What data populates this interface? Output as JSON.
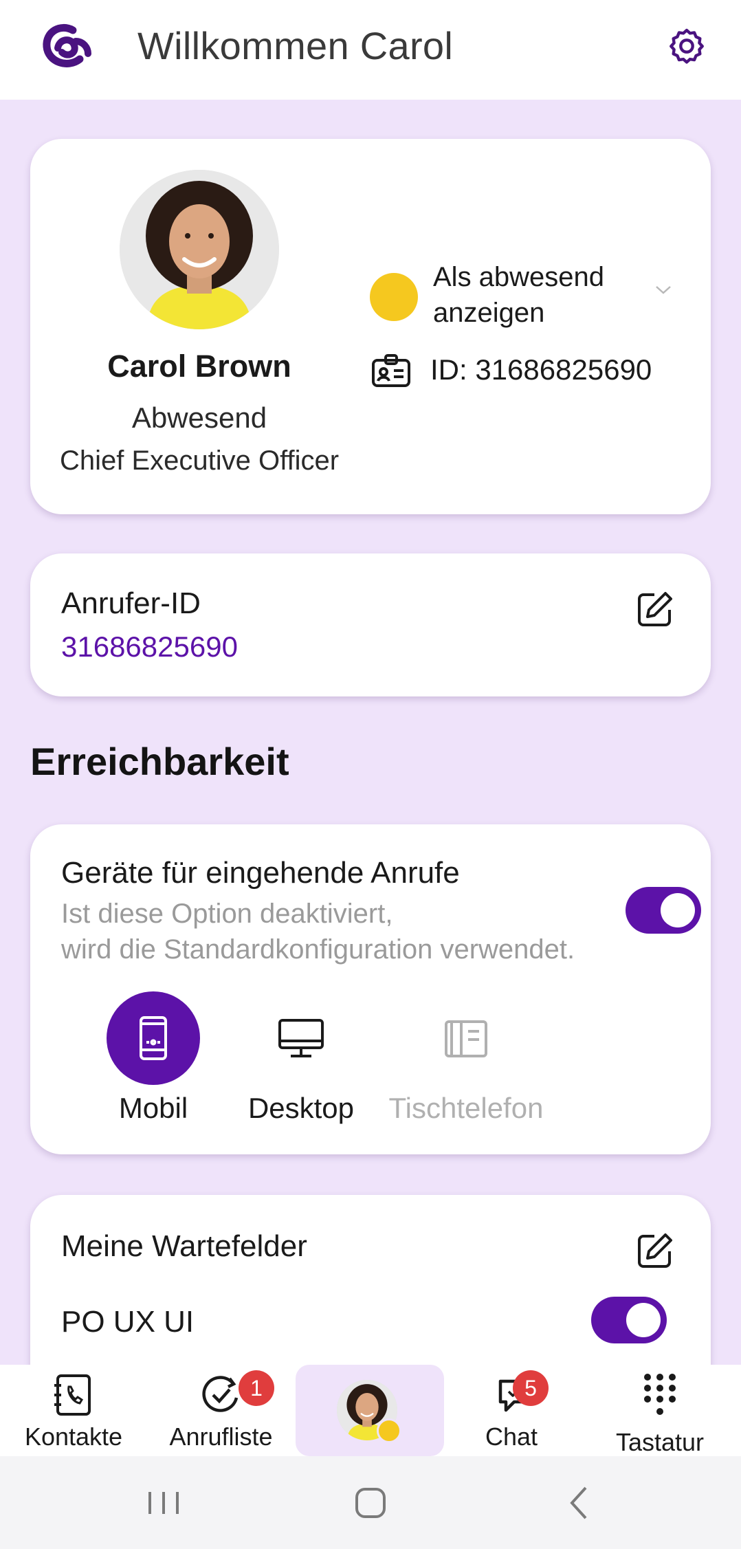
{
  "header": {
    "title": "Willkommen Carol"
  },
  "profile": {
    "name": "Carol Brown",
    "status": "Abwesend",
    "job_title": "Chief Executive Officer",
    "presence_label": "Als abwesend anzeigen",
    "presence_color": "#f5c81f",
    "id_label": "ID: 31686825690"
  },
  "caller_id": {
    "label": "Anrufer-ID",
    "value": "31686825690"
  },
  "reachability": {
    "section_title": "Erreichbarkeit",
    "devices_title": "Geräte für eingehende Anrufe",
    "devices_desc_line1": "Ist diese Option deaktiviert,",
    "devices_desc_line2": "wird die Standardkonfiguration verwendet.",
    "toggle_on": true,
    "devices": [
      {
        "label": "Mobil",
        "icon": "mobile-icon",
        "selected": true
      },
      {
        "label": "Desktop",
        "icon": "desktop-icon",
        "selected": false
      },
      {
        "label": "Tischtelefon",
        "icon": "desk-phone-icon",
        "selected": false,
        "disabled": true
      }
    ]
  },
  "queues": {
    "title": "Meine Wartefelder",
    "items": [
      {
        "label": "PO UX UI",
        "enabled": true
      }
    ]
  },
  "bottom_nav": {
    "items": [
      {
        "label": "Kontakte",
        "icon": "contacts-icon"
      },
      {
        "label": "Anrufliste",
        "icon": "call-history-icon",
        "badge": "1"
      },
      {
        "label": "",
        "icon": "profile-avatar",
        "active": true
      },
      {
        "label": "Chat",
        "icon": "chat-icon",
        "badge": "5"
      },
      {
        "label": "Tastatur",
        "icon": "keypad-icon"
      }
    ]
  },
  "colors": {
    "accent": "#5c12a8",
    "background": "#efe3fa",
    "badge": "#e03d3d"
  }
}
